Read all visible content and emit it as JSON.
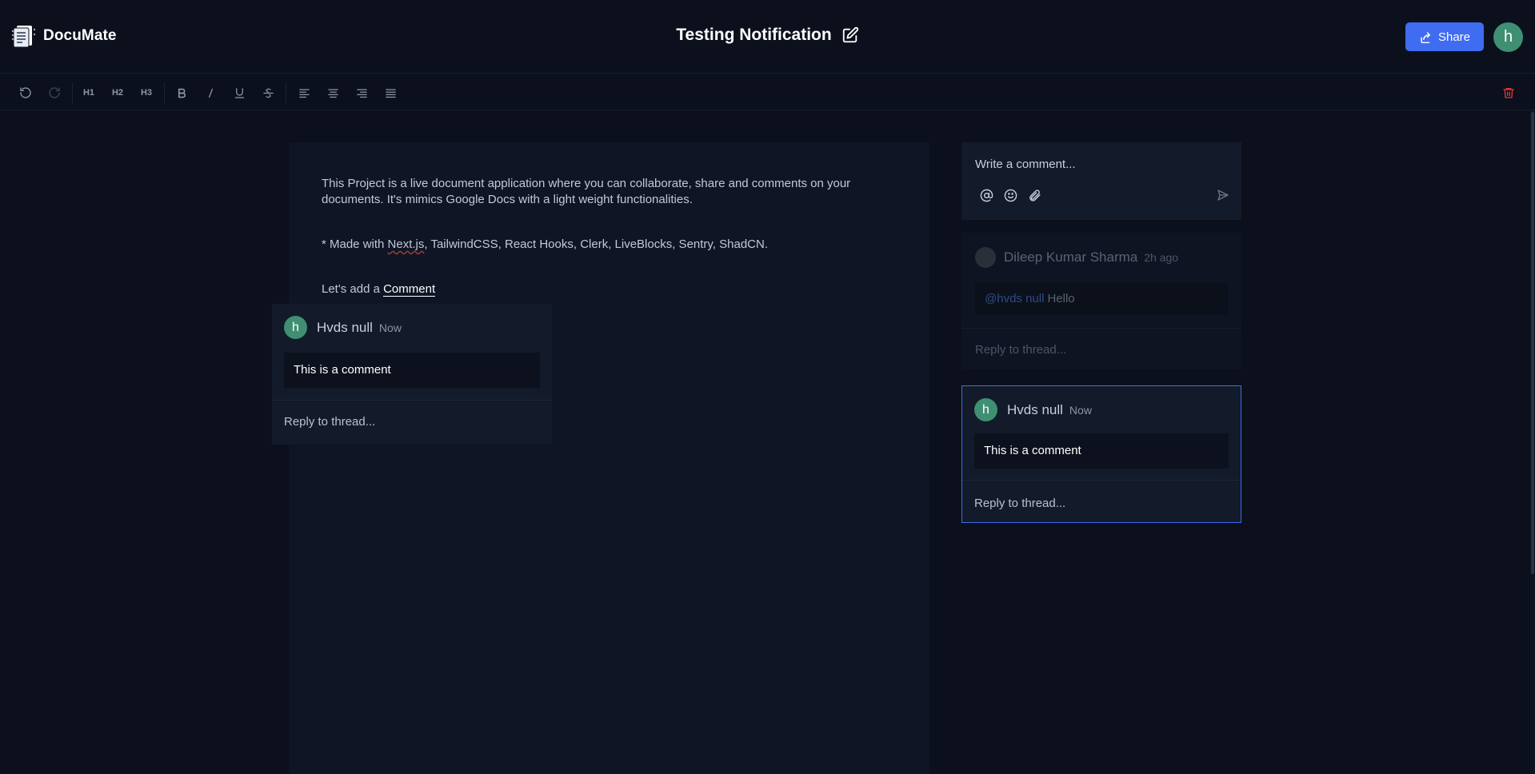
{
  "app": {
    "name": "DocuMate",
    "accent": "#3f6cf0",
    "background": "#0b101c"
  },
  "header": {
    "doc_title": "Testing Notification",
    "share_label": "Share",
    "avatar_letter": "h"
  },
  "toolbar": {
    "h1": "H1",
    "h2": "H2",
    "h3": "H3",
    "buttons": [
      "undo-icon",
      "redo-icon",
      "H1",
      "H2",
      "H3",
      "bold-icon",
      "italic-icon",
      "underline-icon",
      "strikethrough-icon",
      "align-left-icon",
      "align-center-icon",
      "align-right-icon",
      "align-justify-icon",
      "trash-icon"
    ]
  },
  "document": {
    "para1": "This Project is a live document application where you can collaborate, share and comments on your documents. It's mimics Google Docs with a light weight functionalities.",
    "para2_prefix": "* Made with ",
    "para2_nextjs": "Next.js",
    "para2_suffix": ", TailwindCSS, React Hooks, Clerk, LiveBlocks, Sentry, ShadCN.",
    "para3_prefix": "Let's add a ",
    "para3_comment": "Comment"
  },
  "floating_thread": {
    "avatar_letter": "h",
    "author": "Hvds null",
    "time": "Now",
    "body": "This is a comment",
    "reply_placeholder": "Reply to thread..."
  },
  "composer": {
    "placeholder": "Write a comment..."
  },
  "threads": [
    {
      "author": "Dileep Kumar Sharma",
      "time": "2h ago",
      "mention": "@hvds null",
      "body": "Hello",
      "reply_placeholder": "Reply to thread..."
    },
    {
      "avatar_letter": "h",
      "author": "Hvds null",
      "time": "Now",
      "body": "This is a comment",
      "reply_placeholder": "Reply to thread..."
    }
  ]
}
